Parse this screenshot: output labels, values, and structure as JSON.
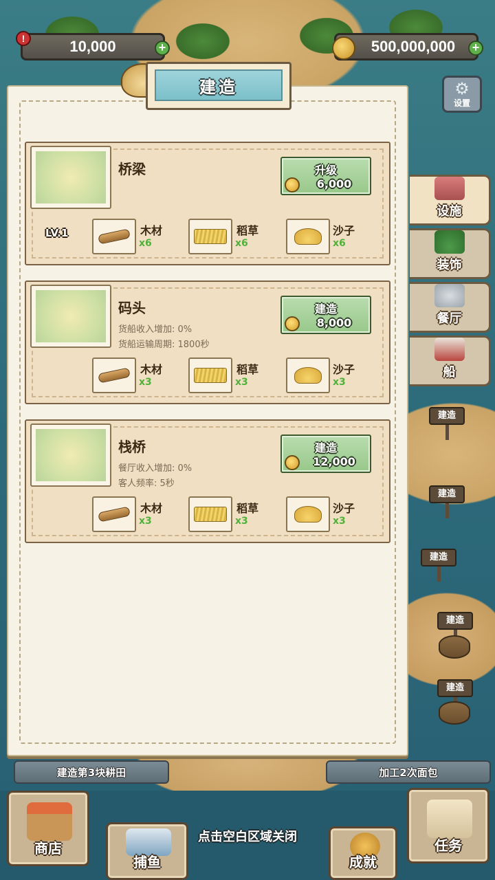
{
  "currency": {
    "gems": "10,000",
    "coins": "500,000,000",
    "plus": "+",
    "alert": "!"
  },
  "settings_label": "设置",
  "panel": {
    "title": "建造",
    "buildings": [
      {
        "name": "桥梁",
        "level": "LV.1",
        "descriptions": [],
        "action": "升级",
        "cost": "6,000",
        "materials": [
          {
            "name": "木材",
            "qty": "x6",
            "icon": "wood-log-icon"
          },
          {
            "name": "稻草",
            "qty": "x6",
            "icon": "straw-bale-icon"
          },
          {
            "name": "沙子",
            "qty": "x6",
            "icon": "sand-pile-icon"
          }
        ]
      },
      {
        "name": "码头",
        "level": "",
        "descriptions": [
          "货船收入增加: 0%",
          "货船运输周期: 1800秒"
        ],
        "action": "建造",
        "cost": "8,000",
        "materials": [
          {
            "name": "木材",
            "qty": "x3",
            "icon": "wood-log-icon"
          },
          {
            "name": "稻草",
            "qty": "x3",
            "icon": "straw-bale-icon"
          },
          {
            "name": "沙子",
            "qty": "x3",
            "icon": "sand-pile-icon"
          }
        ]
      },
      {
        "name": "栈桥",
        "level": "",
        "descriptions": [
          "餐厅收入增加: 0%",
          "客人频率: 5秒"
        ],
        "action": "建造",
        "cost": "12,000",
        "materials": [
          {
            "name": "木材",
            "qty": "x3",
            "icon": "wood-log-icon"
          },
          {
            "name": "稻草",
            "qty": "x3",
            "icon": "straw-bale-icon"
          },
          {
            "name": "沙子",
            "qty": "x3",
            "icon": "sand-pile-icon"
          }
        ]
      }
    ]
  },
  "side_tabs": [
    {
      "label": "设施",
      "active": true
    },
    {
      "label": "装饰",
      "active": false
    },
    {
      "label": "餐厅",
      "active": false
    },
    {
      "label": "船",
      "active": false
    }
  ],
  "build_signs": [
    "建造",
    "建造",
    "建造",
    "建造",
    "建造"
  ],
  "quests": {
    "left": "建造第3块耕田",
    "right": "加工2次面包"
  },
  "close_hint": "点击空白区域关闭",
  "nav": {
    "shop": "商店",
    "fishing": "捕鱼",
    "achievements": "成就",
    "tasks": "任务"
  },
  "colors": {
    "panel_bg": "#f7f2e6",
    "card_bg": "#f1dfc3",
    "button_green": "#98c88a",
    "qty_green": "#4fb23a",
    "sea": "#2c6a7a"
  }
}
